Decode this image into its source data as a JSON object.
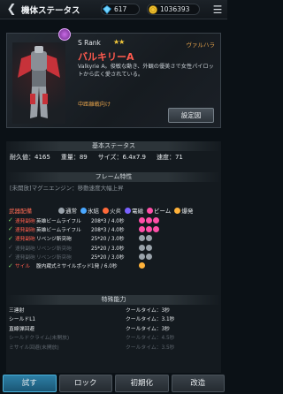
{
  "header": {
    "title": "機体ステータス",
    "gems": "617",
    "coins": "1036393"
  },
  "mech": {
    "rank": "S Rank",
    "stars": "★★",
    "maker": "ヴァルハラ",
    "name": "バルキリーA",
    "description": "Valkyrie A。俊敏な動き、外観の優美さで女性パイロットから広く愛されている。",
    "tag": "中距離戦向け",
    "settings_label": "設定図"
  },
  "basic": {
    "title": "基本ステータス",
    "stats": [
      "耐久値：4165",
      "重量：89",
      "サイズ：6.4x7.9",
      "速度：71"
    ]
  },
  "frame": {
    "title": "フレーム特性",
    "text": "[未開放]マグニエンジン：移動速度大幅上昇"
  },
  "weapons": {
    "title": "武器配備",
    "legend": [
      "通常",
      "氷結",
      "火炎",
      "電磁",
      "ビーム",
      "爆発"
    ],
    "rows": [
      {
        "type": "速発副砲",
        "name": "英雄ビームライフル",
        "stat": "208*3 / 4.0秒",
        "dim": false
      },
      {
        "type": "速発副砲",
        "name": "英雄ビームライフル",
        "stat": "208*3 / 4.0秒",
        "dim": false
      },
      {
        "type": "速発副砲",
        "name": "リベンジ斬突砲",
        "stat": "25*20 / 3.0秒",
        "dim": false
      },
      {
        "type": "速発副砲",
        "name": "リベンジ斬突砲",
        "stat": "25*20 / 3.0秒",
        "dim": true
      },
      {
        "type": "速発副砲",
        "name": "リベンジ斬突砲",
        "stat": "25*20 / 3.0秒",
        "dim": true
      },
      {
        "type": "サイル",
        "name": "腹内蔵式ミサイルポッド",
        "stat": "1発 / 6.0秒",
        "dim": false
      }
    ]
  },
  "special": {
    "title": "特殊能力",
    "rows": [
      {
        "name": "三連射",
        "value": "クールタイム：3秒",
        "dim": false
      },
      {
        "name": "シールドL1",
        "value": "クールタイム：3.1秒",
        "dim": false
      },
      {
        "name": "直線弾回避",
        "value": "クールタイム：3秒",
        "dim": false
      },
      {
        "name": "シールドクライム(未開放)",
        "value": "クールタイム：4.5秒",
        "dim": true
      },
      {
        "name": "ミサイル回避(未開放)",
        "value": "クールタイム：3.5秒",
        "dim": true
      }
    ]
  },
  "bottom": {
    "try": "試す",
    "lock": "ロック",
    "reset": "初期化",
    "modify": "改造"
  },
  "colors": {
    "accent_red": "#ff5a4e",
    "accent_gold": "#e2a04a",
    "primary_btn": "#2d7fa6"
  },
  "icons": {
    "back": "back-arrow-icon",
    "gem": "gem-icon",
    "coin": "coin-icon",
    "menu": "menu-icon",
    "badge": "mech-class-badge-icon"
  }
}
